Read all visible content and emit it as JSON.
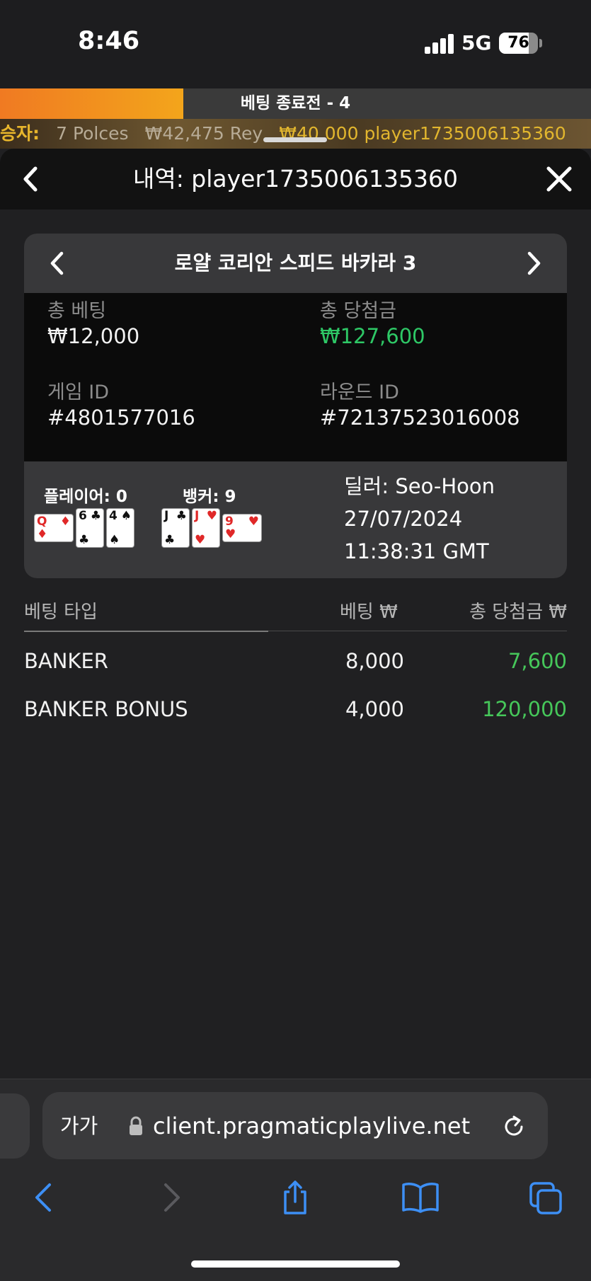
{
  "status_bar": {
    "time": "8:46",
    "network": "5G",
    "battery": "76",
    "battery_level": 0.76
  },
  "betting_bar": {
    "label": "베팅 종료전 - 4",
    "progress": 0.31
  },
  "ticker": {
    "label": "승자:",
    "items": [
      "7 Polces",
      "₩42,475 Rey",
      "₩40,000 player1735006135360"
    ]
  },
  "header": {
    "title": "내역: player1735006135360"
  },
  "game": {
    "name": "로얄 코리안 스피드 바카라 3",
    "total_bet_label": "총 베팅",
    "total_bet": "₩12,000",
    "total_win_label": "총 당첨금",
    "total_win": "₩127,600",
    "game_id_label": "게임 ID",
    "game_id": "#4801577016",
    "round_id_label": "라운드 ID",
    "round_id": "#72137523016008",
    "player_label": "플레이어: 0",
    "banker_label": "뱅커: 9",
    "player_cards": [
      {
        "rank": "Q",
        "suit": "♦",
        "color": "red",
        "sideways": true
      },
      {
        "rank": "6",
        "suit": "♣",
        "color": "black",
        "sideways": false
      },
      {
        "rank": "4",
        "suit": "♠",
        "color": "black",
        "sideways": false
      }
    ],
    "banker_cards": [
      {
        "rank": "J",
        "suit": "♣",
        "color": "black",
        "sideways": false
      },
      {
        "rank": "J",
        "suit": "♥",
        "color": "red",
        "sideways": false
      },
      {
        "rank": "9",
        "suit": "♥",
        "color": "red",
        "sideways": true
      }
    ],
    "dealer": "딜러: Seo-Hoon",
    "date": "27/07/2024",
    "time": "11:38:31 GMT"
  },
  "bets": {
    "headers": {
      "type": "베팅 타입",
      "bet": "베팅 ₩",
      "win": "총 당첨금 ₩"
    },
    "rows": [
      {
        "type": "BANKER",
        "bet": "8,000",
        "win": "7,600"
      },
      {
        "type": "BANKER BONUS",
        "bet": "4,000",
        "win": "120,000"
      }
    ]
  },
  "browser": {
    "aa": "가가",
    "url": "client.pragmaticplaylive.net"
  },
  "colors": {
    "accent_orange": "#f3a51b",
    "win_green": "#2ec866",
    "ticker_gold": "#e2b62e"
  },
  "icons": [
    "chevron-left-icon",
    "close-icon",
    "chevron-right-icon",
    "lock-icon",
    "reload-icon",
    "share-icon",
    "bookmarks-icon",
    "tabs-icon"
  ]
}
